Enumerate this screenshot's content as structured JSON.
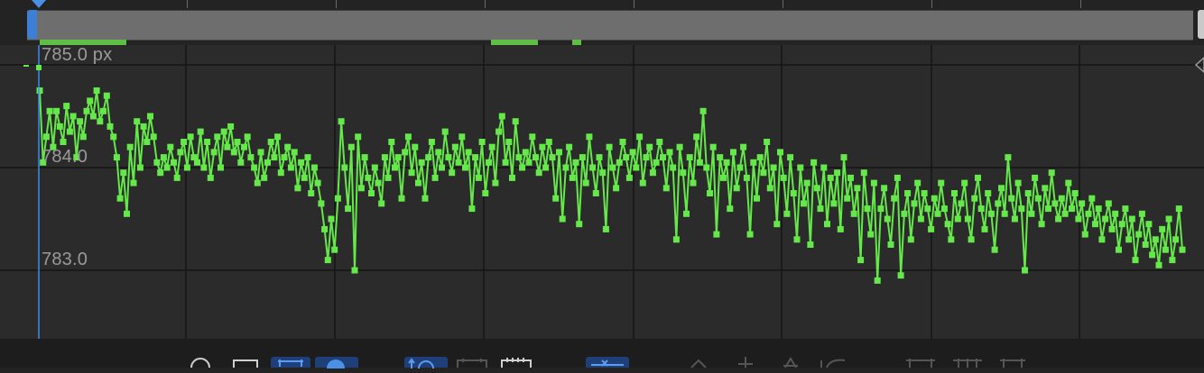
{
  "header": {
    "ruler_icon": "playhead-marker-icon"
  },
  "graph": {
    "top_value_label": "785.0 px",
    "mid_value_label": "784.0",
    "low_value_label": "783.0",
    "curve_color": "#65e84a",
    "playhead_color": "#3d8ee8"
  },
  "chart_data": {
    "type": "line",
    "title": "",
    "ylabel": "",
    "unit": "px",
    "ylim": [
      782.3,
      785.1
    ],
    "series": [
      {
        "values": [
          784.75,
          784.05,
          784.3,
          784.55,
          784.2,
          784.55,
          784.4,
          784.25,
          784.6,
          784.35,
          784.5,
          784.1,
          784.45,
          784.3,
          784.55,
          784.65,
          784.5,
          784.75,
          784.45,
          784.55,
          784.7,
          784.4,
          784.3,
          784.1,
          783.7,
          783.95,
          783.55,
          784.2,
          783.85,
          784.45,
          784.0,
          784.4,
          784.25,
          784.5,
          784.3,
          784.05,
          783.95,
          784.1,
          784.0,
          784.2,
          784.05,
          783.9,
          784.15,
          784.25,
          784.0,
          784.3,
          784.1,
          784.05,
          784.35,
          784.0,
          784.25,
          783.9,
          784.15,
          784.3,
          784.0,
          784.35,
          784.2,
          784.4,
          784.15,
          784.25,
          784.05,
          784.2,
          784.3,
          784.1,
          784.0,
          783.85,
          784.15,
          783.9,
          784.05,
          784.25,
          784.1,
          784.3,
          783.95,
          784.1,
          784.2,
          784.0,
          784.15,
          783.8,
          784.05,
          783.9,
          784.1,
          783.75,
          784.0,
          783.85,
          783.65,
          783.4,
          783.1,
          783.5,
          783.2,
          783.7,
          784.45,
          784.0,
          783.6,
          784.2,
          783.0,
          784.3,
          783.8,
          784.1,
          783.9,
          783.75,
          784.0,
          783.85,
          783.65,
          784.1,
          783.9,
          784.25,
          784.0,
          784.1,
          783.7,
          784.15,
          784.3,
          783.95,
          784.2,
          783.85,
          784.05,
          783.7,
          784.1,
          784.25,
          783.9,
          784.15,
          784.0,
          784.35,
          784.1,
          783.95,
          784.2,
          784.05,
          784.3,
          784.0,
          784.15,
          783.6,
          784.1,
          783.9,
          784.25,
          783.75,
          784.05,
          784.2,
          783.85,
          784.35,
          784.5,
          784.05,
          784.25,
          783.9,
          784.45,
          784.1,
          784.0,
          784.15,
          784.05,
          784.3,
          784.1,
          783.95,
          784.2,
          784.0,
          784.25,
          784.1,
          783.7,
          784.15,
          783.5,
          784.0,
          784.2,
          783.9,
          784.05,
          783.45,
          784.1,
          783.85,
          784.3,
          784.0,
          783.75,
          784.1,
          783.95,
          783.4,
          784.2,
          784.0,
          783.8,
          784.05,
          784.25,
          784.1,
          783.9,
          784.15,
          784.0,
          784.3,
          783.85,
          784.1,
          784.2,
          783.95,
          784.05,
          784.25,
          784.1,
          783.8,
          784.15,
          784.0,
          783.3,
          784.2,
          783.95,
          783.55,
          784.1,
          783.85,
          784.3,
          784.05,
          784.55,
          784.0,
          783.75,
          784.2,
          783.35,
          784.1,
          783.9,
          784.05,
          783.6,
          784.15,
          783.8,
          784.0,
          784.2,
          783.9,
          783.35,
          784.05,
          783.7,
          784.1,
          783.95,
          784.25,
          783.8,
          784.0,
          783.45,
          784.15,
          783.9,
          783.55,
          784.1,
          783.75,
          783.3,
          784.0,
          783.65,
          783.85,
          783.25,
          784.05,
          783.8,
          783.6,
          784.0,
          783.45,
          783.9,
          783.65,
          783.95,
          783.4,
          784.1,
          783.7,
          783.9,
          783.55,
          783.8,
          783.1,
          783.95,
          783.6,
          783.35,
          783.85,
          782.9,
          783.6,
          783.8,
          783.5,
          783.25,
          783.7,
          783.9,
          782.95,
          783.55,
          783.75,
          783.3,
          783.65,
          783.85,
          783.5,
          783.75,
          783.6,
          783.4,
          783.7,
          783.55,
          783.85,
          783.6,
          783.45,
          783.3,
          783.75,
          783.5,
          783.65,
          783.85,
          783.5,
          783.3,
          783.7,
          783.9,
          783.6,
          783.4,
          783.75,
          783.55,
          783.2,
          783.65,
          783.8,
          783.55,
          784.1,
          783.7,
          783.5,
          783.85,
          783.6,
          783.0,
          783.75,
          783.55,
          783.9,
          783.7,
          783.45,
          783.8,
          783.6,
          783.95,
          783.65,
          783.5,
          783.7,
          783.55,
          783.85,
          783.6,
          783.75,
          783.5,
          783.65,
          783.35,
          783.55,
          783.7,
          783.45,
          783.6,
          783.3,
          783.5,
          783.65,
          783.4,
          783.55,
          783.2,
          783.45,
          783.6,
          783.3,
          783.5,
          783.1,
          783.35,
          783.55,
          783.25,
          783.45,
          783.15,
          783.3,
          783.05,
          783.4,
          783.2,
          783.5,
          783.1,
          783.3,
          783.6,
          783.2
        ]
      }
    ]
  },
  "toolbar": {
    "icons": [
      "eye-icon",
      "show-properties-icon",
      "fit-all-icon",
      "graph-type-icon",
      "snap-icon",
      "auto-zoom-icon",
      "fit-selection-icon",
      "separate-dimensions-icon",
      "keyframe-hold-icon",
      "keyframe-linear-icon",
      "keyframe-auto-bezier-icon",
      "easy-ease-icon",
      "easy-ease-in-icon",
      "easy-ease-out-icon"
    ]
  }
}
